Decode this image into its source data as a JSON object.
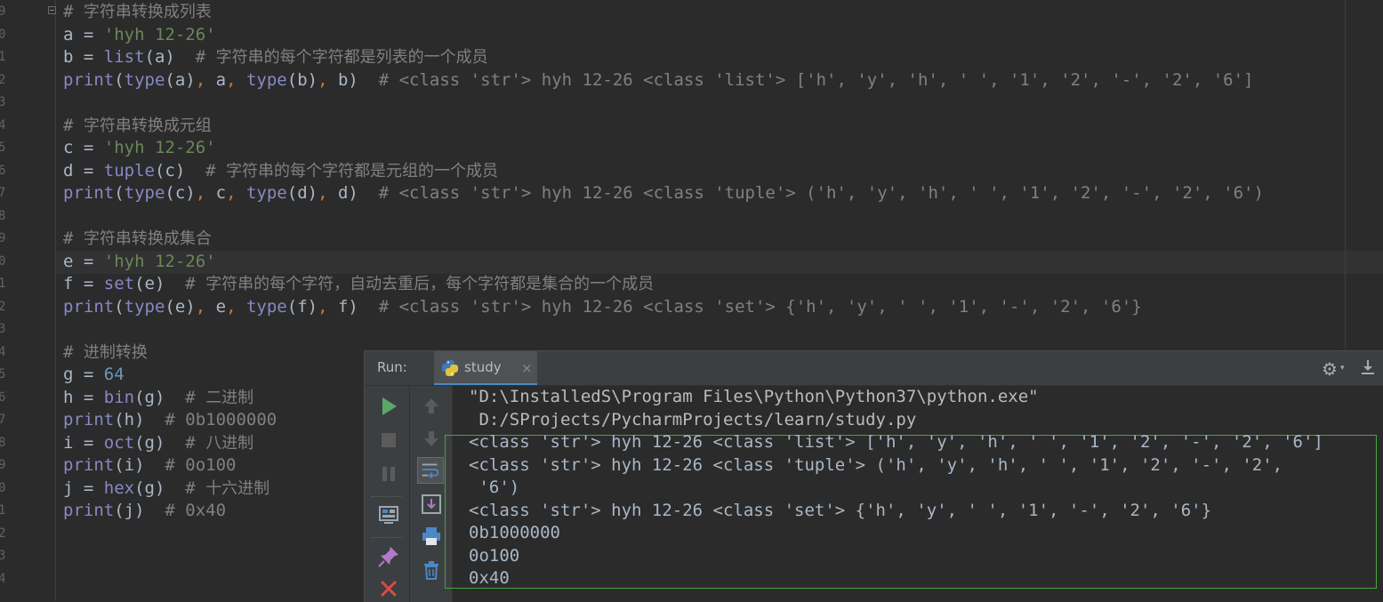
{
  "editor": {
    "gutter_digits": [
      "9",
      "0",
      "1",
      "2",
      "3",
      "4",
      "5",
      "6",
      "7",
      "8",
      "9",
      "0",
      "1",
      "2",
      "3",
      "4",
      "5",
      "6",
      "7",
      "8",
      "9",
      "0",
      "1",
      "2",
      "3",
      "4"
    ],
    "lines": [
      {
        "tokens": [
          [
            "cm",
            "# "
          ],
          [
            "cmc",
            "字符串转换成列表"
          ]
        ]
      },
      {
        "tokens": [
          [
            "tx",
            "a = "
          ],
          [
            "str",
            "'hyh 12-26'"
          ]
        ]
      },
      {
        "tokens": [
          [
            "tx",
            "b = "
          ],
          [
            "bi",
            "list"
          ],
          [
            "tx",
            "(a)  "
          ],
          [
            "cm",
            "# "
          ],
          [
            "cmc",
            "字符串的每个字符都是列表的一个成员"
          ]
        ]
      },
      {
        "tokens": [
          [
            "bi",
            "print"
          ],
          [
            "tx",
            "("
          ],
          [
            "bi",
            "type"
          ],
          [
            "tx",
            "(a)"
          ],
          [
            "pu",
            ", "
          ],
          [
            "tx",
            "a"
          ],
          [
            "pu",
            ", "
          ],
          [
            "bi",
            "type"
          ],
          [
            "tx",
            "(b)"
          ],
          [
            "pu",
            ", "
          ],
          [
            "tx",
            "b)  "
          ],
          [
            "cm",
            "# <class 'str'> hyh 12-26 <class 'list'> ['h', 'y', 'h', ' ', '1', '2', '-', '2', '6']"
          ]
        ]
      },
      {
        "tokens": []
      },
      {
        "tokens": [
          [
            "cm",
            "# "
          ],
          [
            "cmc",
            "字符串转换成元组"
          ]
        ]
      },
      {
        "tokens": [
          [
            "tx",
            "c = "
          ],
          [
            "str",
            "'hyh 12-26'"
          ]
        ]
      },
      {
        "tokens": [
          [
            "tx",
            "d = "
          ],
          [
            "bi",
            "tuple"
          ],
          [
            "tx",
            "(c)  "
          ],
          [
            "cm",
            "# "
          ],
          [
            "cmc",
            "字符串的每个字符都是元组的一个成员"
          ]
        ]
      },
      {
        "tokens": [
          [
            "bi",
            "print"
          ],
          [
            "tx",
            "("
          ],
          [
            "bi",
            "type"
          ],
          [
            "tx",
            "(c)"
          ],
          [
            "pu",
            ", "
          ],
          [
            "tx",
            "c"
          ],
          [
            "pu",
            ", "
          ],
          [
            "bi",
            "type"
          ],
          [
            "tx",
            "(d)"
          ],
          [
            "pu",
            ", "
          ],
          [
            "tx",
            "d)  "
          ],
          [
            "cm",
            "# <class 'str'> hyh 12-26 <class 'tuple'> ('h', 'y', 'h', ' ', '1', '2', '-', '2', '6')"
          ]
        ]
      },
      {
        "tokens": []
      },
      {
        "tokens": [
          [
            "cm",
            "# "
          ],
          [
            "cmc",
            "字符串转换成集合"
          ]
        ]
      },
      {
        "tokens": [
          [
            "tx",
            "e = "
          ],
          [
            "str",
            "'hyh 12-26'"
          ]
        ]
      },
      {
        "tokens": [
          [
            "tx",
            "f = "
          ],
          [
            "bi",
            "set"
          ],
          [
            "tx",
            "(e)  "
          ],
          [
            "cm",
            "# "
          ],
          [
            "cmc",
            "字符串的每个字符，自动去重后，每个字符都是集合的一个成员"
          ]
        ]
      },
      {
        "tokens": [
          [
            "bi",
            "print"
          ],
          [
            "tx",
            "("
          ],
          [
            "bi",
            "type"
          ],
          [
            "tx",
            "(e)"
          ],
          [
            "pu",
            ", "
          ],
          [
            "tx",
            "e"
          ],
          [
            "pu",
            ", "
          ],
          [
            "bi",
            "type"
          ],
          [
            "tx",
            "(f)"
          ],
          [
            "pu",
            ", "
          ],
          [
            "tx",
            "f)  "
          ],
          [
            "cm",
            "# <class 'str'> hyh 12-26 <class 'set'> {'h', 'y', ' ', '1', '-', '2', '6'}"
          ]
        ]
      },
      {
        "tokens": []
      },
      {
        "tokens": [
          [
            "cm",
            "# "
          ],
          [
            "cmc",
            "进制转换"
          ]
        ]
      },
      {
        "tokens": [
          [
            "tx",
            "g = "
          ],
          [
            "num",
            "64"
          ]
        ]
      },
      {
        "tokens": [
          [
            "tx",
            "h = "
          ],
          [
            "bi",
            "bin"
          ],
          [
            "tx",
            "(g)  "
          ],
          [
            "cm",
            "# "
          ],
          [
            "cmc",
            "二进制"
          ]
        ]
      },
      {
        "tokens": [
          [
            "bi",
            "print"
          ],
          [
            "tx",
            "(h)  "
          ],
          [
            "cm",
            "# 0b1000000"
          ]
        ]
      },
      {
        "tokens": [
          [
            "tx",
            "i = "
          ],
          [
            "bi",
            "oct"
          ],
          [
            "tx",
            "(g)  "
          ],
          [
            "cm",
            "# "
          ],
          [
            "cmc",
            "八进制"
          ]
        ]
      },
      {
        "tokens": [
          [
            "bi",
            "print"
          ],
          [
            "tx",
            "(i)  "
          ],
          [
            "cm",
            "# 0o100"
          ]
        ]
      },
      {
        "tokens": [
          [
            "tx",
            "j = "
          ],
          [
            "bi",
            "hex"
          ],
          [
            "tx",
            "(g)  "
          ],
          [
            "cm",
            "# "
          ],
          [
            "cmc",
            "十六进制"
          ]
        ]
      },
      {
        "tokens": [
          [
            "bi",
            "print"
          ],
          [
            "tx",
            "(j)  "
          ],
          [
            "cm",
            "# 0x40"
          ]
        ]
      }
    ]
  },
  "run_panel": {
    "label": "Run:",
    "tab_label": "study",
    "tab_close": "×",
    "settings_glyph": "⚙",
    "settings_caret": "▾"
  },
  "console": {
    "lines": [
      {
        "text": "\"D:\\InstalledS\\Program Files\\Python\\Python37\\python.exe\"",
        "kind": "path"
      },
      {
        "text": " D:/SProjects/PycharmProjects/learn/study.py",
        "kind": "path"
      },
      {
        "text": "<class 'str'> hyh 12-26 <class 'list'> ['h', 'y', 'h', ' ', '1', '2', '-', '2', '6']",
        "kind": "out"
      },
      {
        "text": "<class 'str'> hyh 12-26 <class 'tuple'> ('h', 'y', 'h', ' ', '1', '2', '-', '2',",
        "kind": "out"
      },
      {
        "text": " '6')",
        "kind": "out"
      },
      {
        "text": "<class 'str'> hyh 12-26 <class 'set'> {'h', 'y', ' ', '1', '-', '2', '6'}",
        "kind": "out"
      },
      {
        "text": "0b1000000",
        "kind": "out"
      },
      {
        "text": "0o100",
        "kind": "out"
      },
      {
        "text": "0x40",
        "kind": "out"
      }
    ]
  },
  "colors": {
    "background": "#2b2b2b",
    "comment": "#808080",
    "string": "#6a8759",
    "number": "#6897bb",
    "builtin": "#8888c6",
    "punct": "#cc7832",
    "run_green": "#59a869",
    "stop_red": "#e04a3f",
    "selection_border": "#45a83d"
  }
}
